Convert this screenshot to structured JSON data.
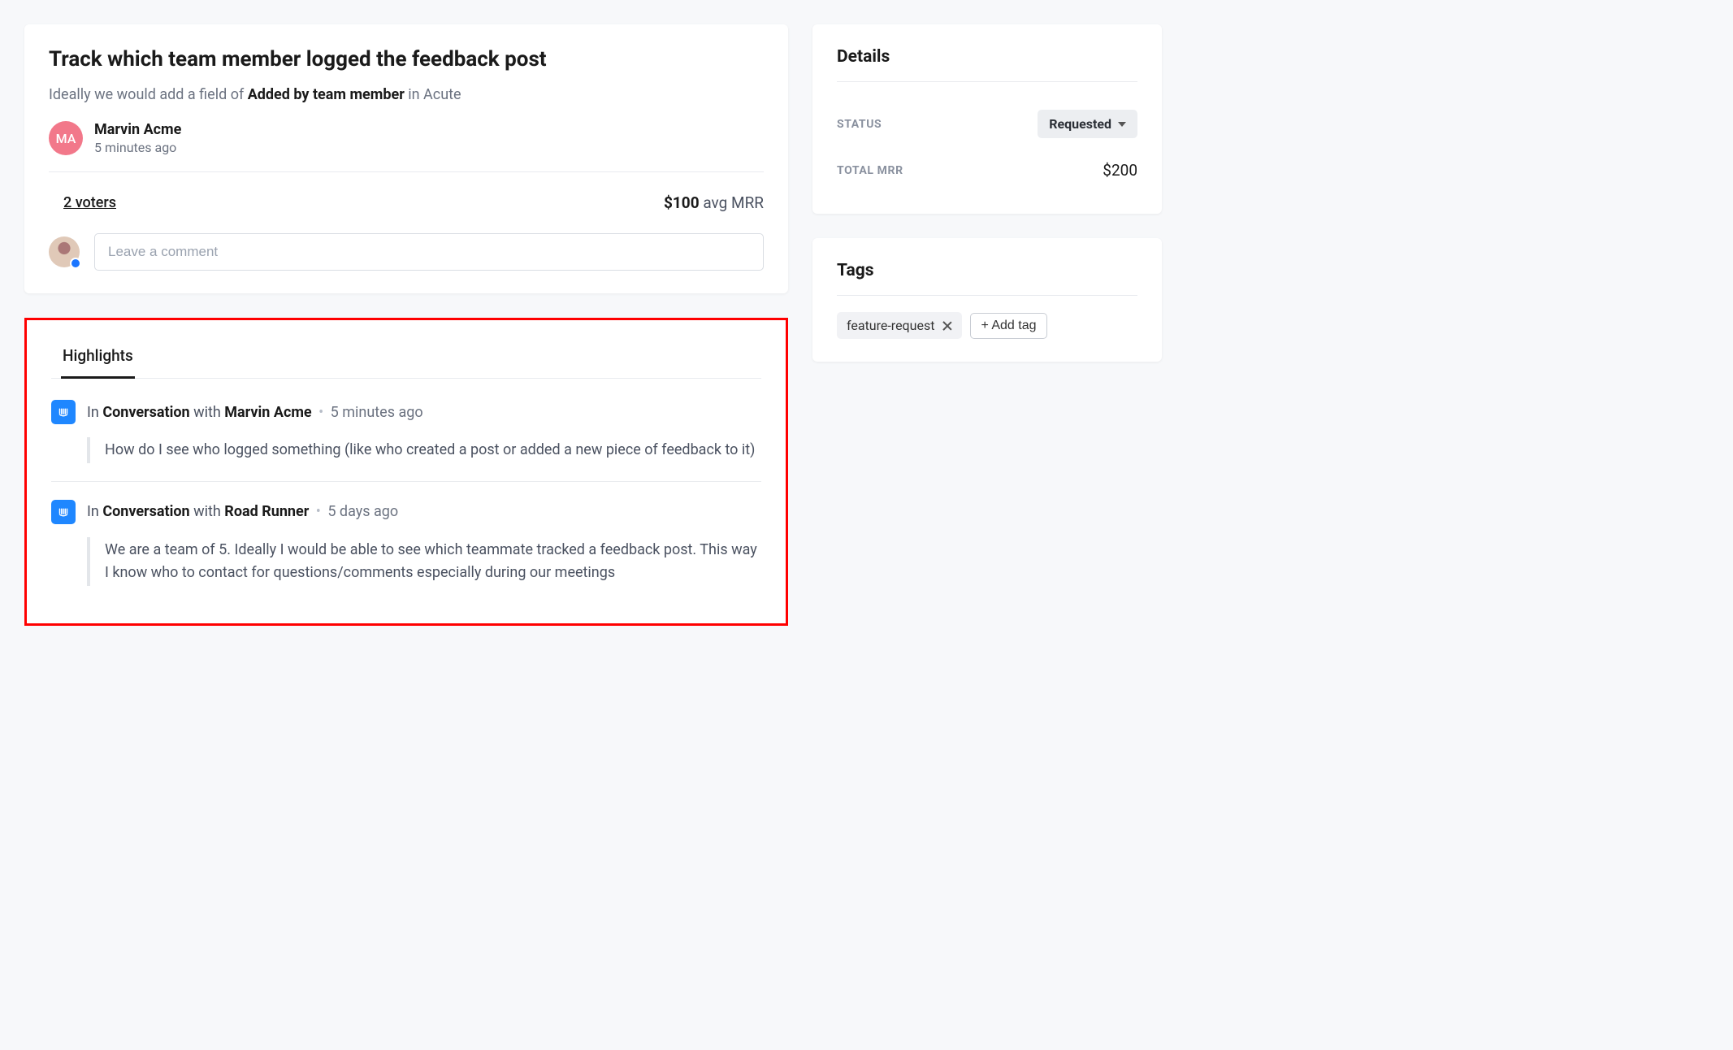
{
  "post": {
    "title": "Track which team member logged the feedback post",
    "desc_pre": "Ideally we would add a field of ",
    "desc_bold": "Added by team member",
    "desc_post": " in Acute",
    "author": {
      "initials": "MA",
      "name": "Marvin Acme",
      "time": "5 minutes ago"
    },
    "voters": "2 voters",
    "mrr_value": "$100",
    "mrr_suffix": " avg MRR",
    "comment_placeholder": "Leave a comment"
  },
  "highlights": {
    "tab": "Highlights",
    "items": [
      {
        "prefix": "In ",
        "conv": "Conversation",
        "mid": " with ",
        "name": "Marvin Acme",
        "time": "5 minutes ago",
        "quote": "How do I see who logged something (like who created a post or added a new piece of feedback to it)"
      },
      {
        "prefix": "In ",
        "conv": "Conversation",
        "mid": " with ",
        "name": "Road Runner",
        "time": "5 days ago",
        "quote": "We are a team of 5. Ideally I would be able to see which teammate tracked a feedback post. This way I know who to contact for questions/comments especially during our meetings"
      }
    ]
  },
  "details": {
    "title": "Details",
    "status_label": "STATUS",
    "status_value": "Requested",
    "mrr_label": "TOTAL MRR",
    "mrr_value": "$200"
  },
  "tags": {
    "title": "Tags",
    "items": [
      "feature-request"
    ],
    "add_label": "+ Add tag"
  }
}
